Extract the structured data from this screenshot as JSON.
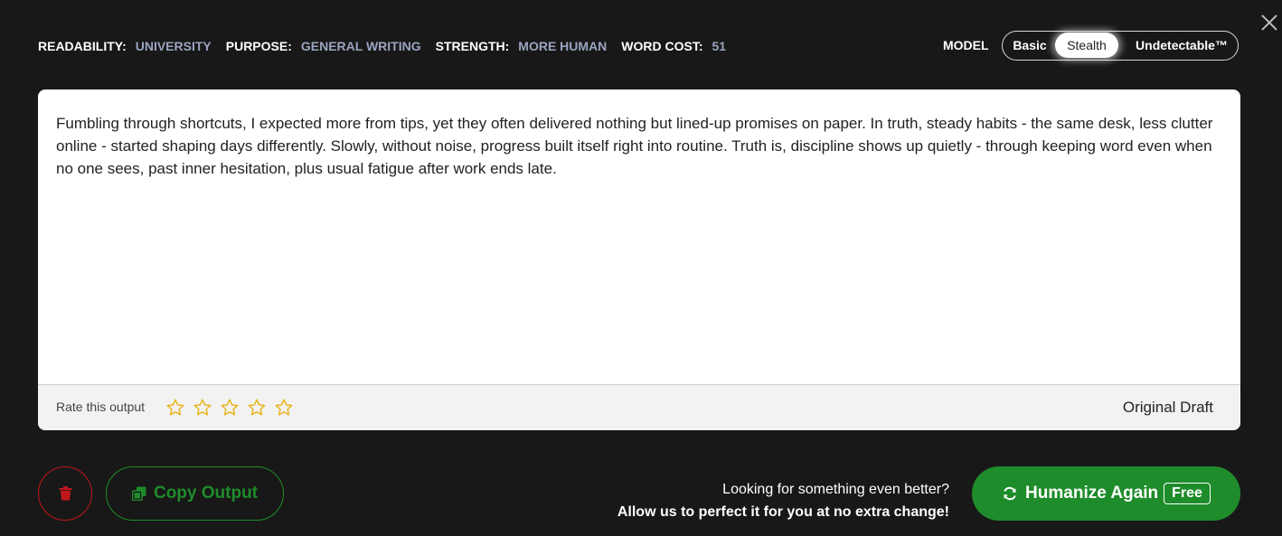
{
  "settings": [
    {
      "key": "READABILITY:",
      "value": "UNIVERSITY"
    },
    {
      "key": "PURPOSE:",
      "value": "GENERAL WRITING"
    },
    {
      "key": "STRENGTH:",
      "value": "MORE HUMAN"
    },
    {
      "key": "WORD COST:",
      "value": "51"
    }
  ],
  "model": {
    "label": "MODEL",
    "options": [
      "Basic",
      "Stealth",
      "Undetectable™"
    ],
    "selected": "Stealth"
  },
  "output": {
    "text": "Fumbling through shortcuts, I expected more from tips, yet they often delivered nothing but lined-up promises on paper. In truth, steady habits - the same desk, less clutter online - started shaping days differently. Slowly, without noise, progress built itself right into routine. Truth is, discipline shows up quietly - through keeping word even when no one sees, past inner hesitation, plus usual fatigue after work ends late.",
    "rate_label": "Rate this output",
    "rating": 0,
    "max_rating": 5,
    "draft_label": "Original Draft"
  },
  "actions": {
    "copy_label": "Copy Output",
    "promo_line1": "Looking for something even better?",
    "promo_line2": "Allow us to perfect it for you at no extra change!",
    "humanize_label": "Humanize Again",
    "free_badge": "Free"
  },
  "icons": {
    "close": "close-icon",
    "star": "star-outline-icon",
    "trash": "trash-icon",
    "copy": "copy-icon",
    "refresh": "refresh-icon"
  },
  "colors": {
    "background": "#181818",
    "accent_green": "#1e8c2a",
    "danger_red": "#c0171b",
    "setting_value": "#9aa4c0",
    "star_gold": "#e8b41b"
  }
}
